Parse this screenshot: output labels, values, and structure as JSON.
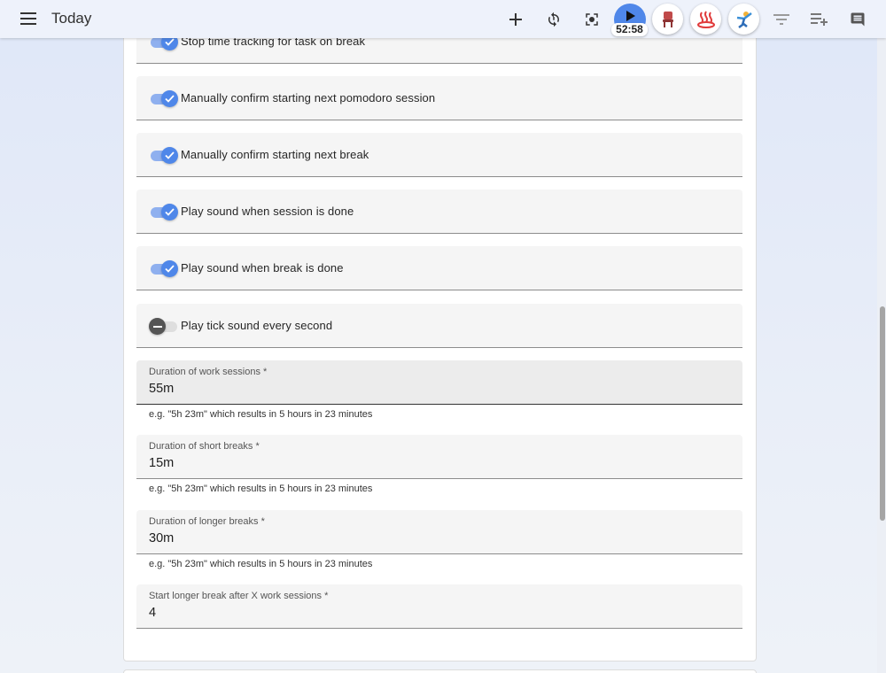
{
  "header": {
    "title": "Today",
    "timer": "52:58",
    "icons": {
      "menu": "hamburger-menu-icon",
      "add": "plus-icon",
      "sync": "sync-icon",
      "focus": "focus-mode-icon",
      "play": "play-icon",
      "chair": "chair-icon",
      "hot-spring": "hot-spring-icon",
      "exercise": "exercise-icon",
      "filter": "filter-icon",
      "add-list": "playlist-add-icon",
      "notes": "comment-icon"
    }
  },
  "settings": {
    "toggles": [
      {
        "label": "Stop time tracking for task on break",
        "checked": true
      },
      {
        "label": "Manually confirm starting next pomodoro session",
        "checked": true
      },
      {
        "label": "Manually confirm starting next break",
        "checked": true
      },
      {
        "label": "Play sound when session is done",
        "checked": true
      },
      {
        "label": "Play sound when break is done",
        "checked": true
      },
      {
        "label": "Play tick sound every second",
        "checked": false
      }
    ],
    "fields": [
      {
        "label": "Duration of work sessions *",
        "value": "55m",
        "hint": "e.g. \"5h 23m\" which results in 5 hours in 23 minutes"
      },
      {
        "label": "Duration of short breaks *",
        "value": "15m",
        "hint": "e.g. \"5h 23m\" which results in 5 hours in 23 minutes"
      },
      {
        "label": "Duration of longer breaks *",
        "value": "30m",
        "hint": "e.g. \"5h 23m\" which results in 5 hours in 23 minutes"
      },
      {
        "label": "Start longer break after X work sessions *",
        "value": "4"
      }
    ]
  },
  "colors": {
    "accent": "#4f87e9",
    "accent_light": "#8fb0ef",
    "field_bg": "#f5f5f5"
  }
}
